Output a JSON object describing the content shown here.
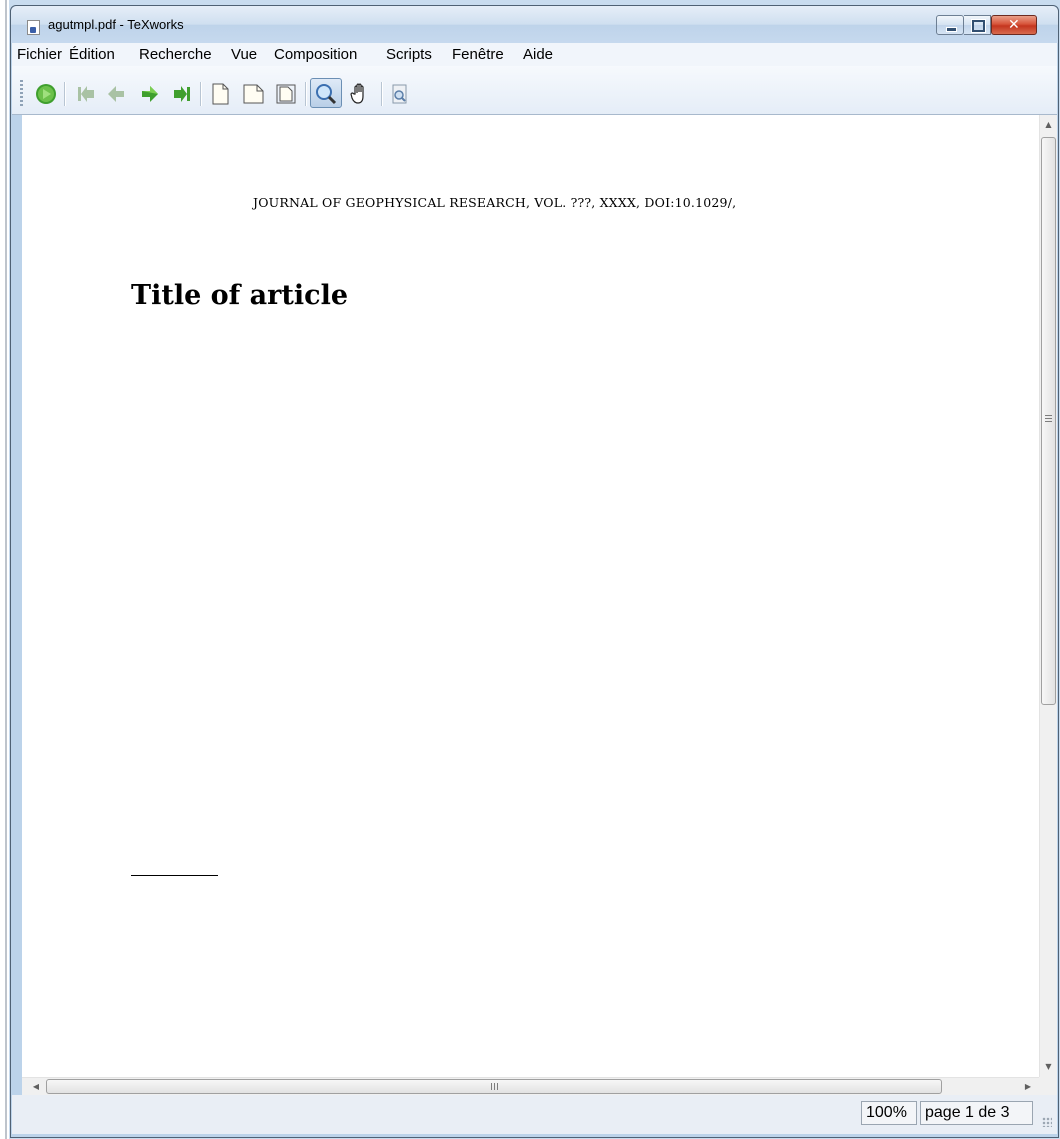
{
  "window": {
    "title": "agutmpl.pdf - TeXworks",
    "close_glyph": "✕"
  },
  "menubar": {
    "items": [
      "Fichier",
      "Édition",
      "Recherche",
      "Vue",
      "Composition",
      "Scripts",
      "Fenêtre",
      "Aide"
    ]
  },
  "toolbar": {
    "icons": [
      "typeset-icon",
      "first-page-icon",
      "previous-page-icon",
      "next-page-icon",
      "last-page-icon",
      "actual-size-icon",
      "fit-width-icon",
      "fit-window-icon",
      "magnify-tool-icon",
      "hand-tool-icon",
      "find-source-icon"
    ]
  },
  "document": {
    "running_header": "JOURNAL OF GEOPHYSICAL RESEARCH, VOL. ???, XXXX, DOI:10.1029/,",
    "title": "Title of article"
  },
  "scrollbar": {
    "horizontal_grip": "III",
    "vertical_grip": "≡"
  },
  "statusbar": {
    "zoom": "100%",
    "page": "page 1 de 3"
  }
}
